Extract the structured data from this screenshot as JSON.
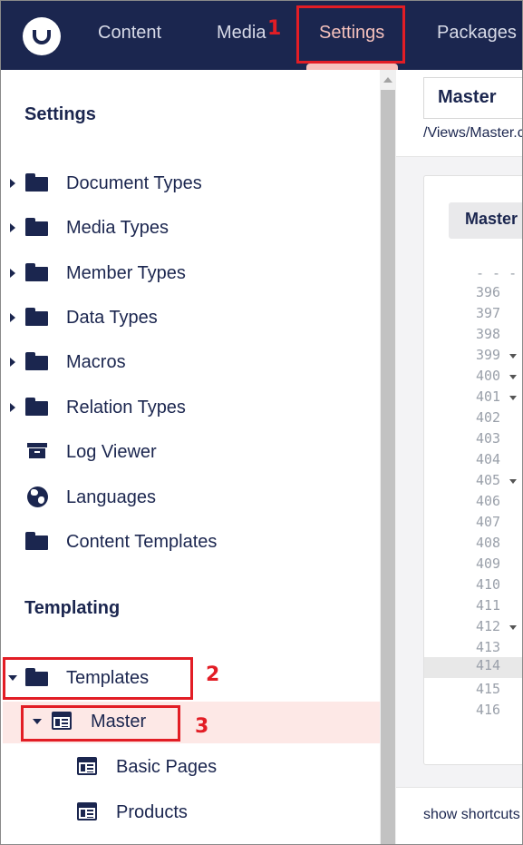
{
  "header": {
    "nav": [
      {
        "label": "Content"
      },
      {
        "label": "Media"
      },
      {
        "label": "Settings"
      },
      {
        "label": "Packages"
      }
    ]
  },
  "annotations": {
    "one": "1",
    "two": "2",
    "three": "3",
    "color": "#e21d25"
  },
  "sidebar": {
    "settings_title": "Settings",
    "settings_items": [
      {
        "label": "Document Types",
        "icon": "folder-icon"
      },
      {
        "label": "Media Types",
        "icon": "folder-icon"
      },
      {
        "label": "Member Types",
        "icon": "folder-icon"
      },
      {
        "label": "Data Types",
        "icon": "folder-icon"
      },
      {
        "label": "Macros",
        "icon": "folder-icon"
      },
      {
        "label": "Relation Types",
        "icon": "folder-icon"
      },
      {
        "label": "Log Viewer",
        "icon": "archive-icon"
      },
      {
        "label": "Languages",
        "icon": "globe-icon"
      },
      {
        "label": "Content Templates",
        "icon": "folder-icon"
      }
    ],
    "templating_title": "Templating",
    "templating_items": [
      {
        "label": "Templates",
        "icon": "folder-icon"
      },
      {
        "label": "Master",
        "icon": "template-icon"
      },
      {
        "label": "Basic Pages",
        "icon": "template-icon"
      },
      {
        "label": "Products",
        "icon": "template-icon"
      }
    ]
  },
  "editor": {
    "name_value": "Master",
    "path": "/Views/Master.cshtml",
    "tab_label": "Master",
    "line_numbers": [
      "- - -",
      "396",
      "397",
      "398",
      "399",
      "400",
      "401",
      "402",
      "403",
      "404",
      "405",
      "406",
      "407",
      "408",
      "409",
      "410",
      "411",
      "412",
      "413",
      "414",
      "415",
      "416"
    ],
    "footer_text": "show shortcuts"
  },
  "colors": {
    "header_bg": "#1b264f",
    "active_nav": "#f5c1bc",
    "selected_row": "#fde8e6"
  }
}
